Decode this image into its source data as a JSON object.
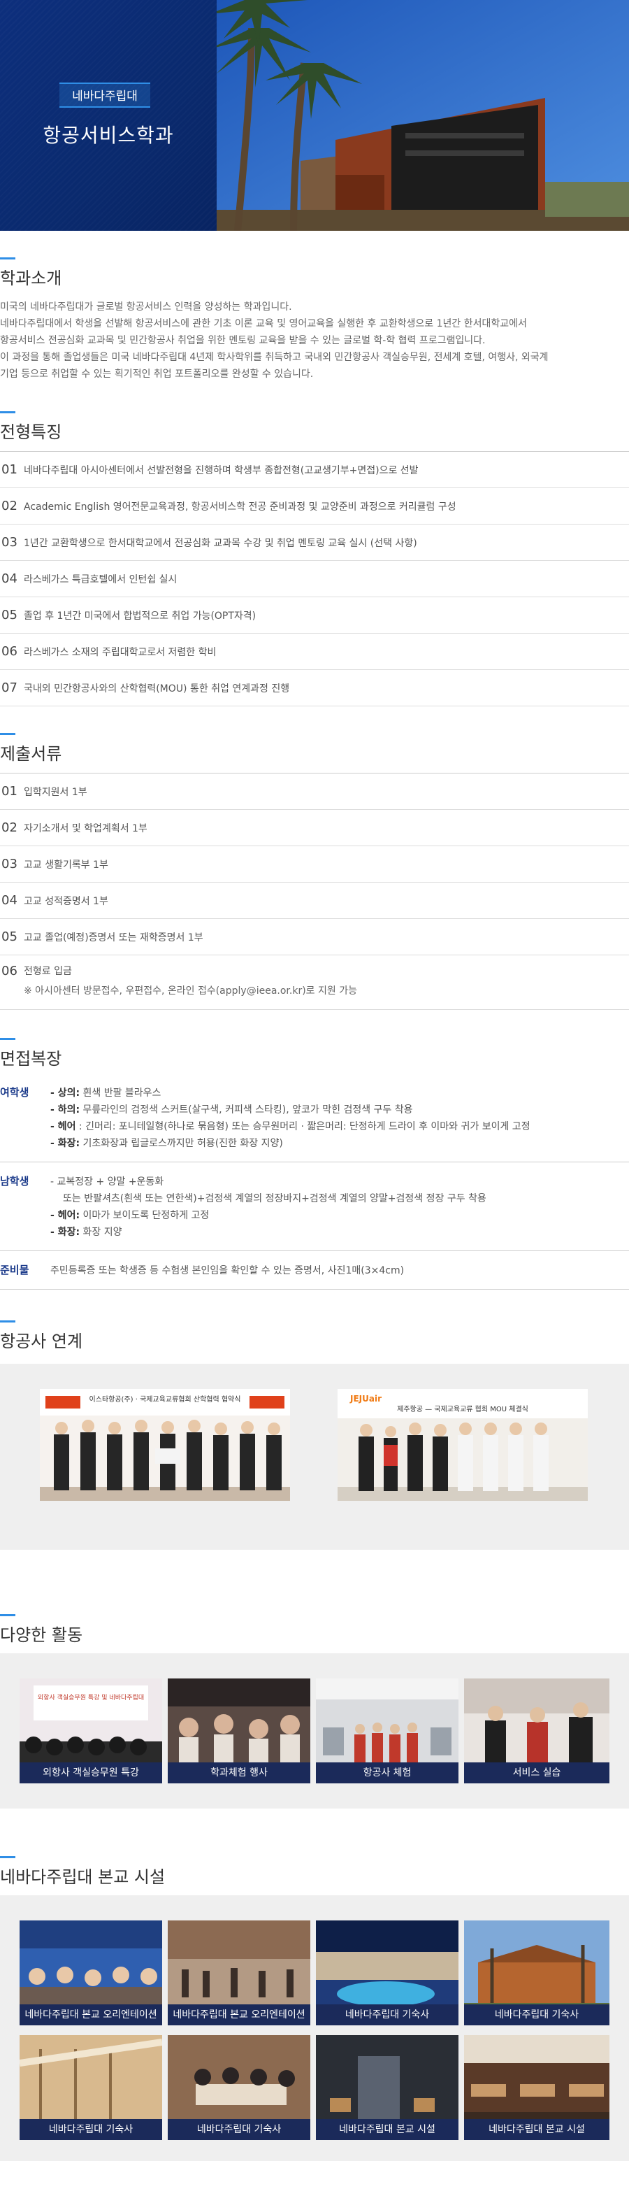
{
  "hero": {
    "badge": "네바다주립대",
    "title": "항공서비스학과",
    "photo_colors": {
      "sky": "#2a67c7",
      "building": "#8a3a1e"
    }
  },
  "intro": {
    "title": "학과소개",
    "lines": [
      "미국의 네바다주립대가 글로벌 항공서비스 인력을 양성하는 학과입니다.",
      "네바다주립대에서 학생을 선발해 항공서비스에 관한 기초 이론 교육 및 영어교육을 실행한 후 교환학생으로 1년간 한서대학교에서",
      "항공서비스 전공심화 교과목 및 민간항공사 취업을 위한 멘토링 교육을 받을 수 있는 글로벌 학-학 협력 프로그램입니다.",
      "이 과정을 통해 졸업생들은 미국 네바다주립대 4년제 학사학위를 취득하고 국내외 민간항공사 객실승무원, 전세계 호텔, 여행사, 외국계",
      "기업 등으로 취업할 수 있는 획기적인 취업 포트폴리오를 완성할 수 있습니다."
    ]
  },
  "features": {
    "title": "전형특징",
    "items": [
      {
        "num": "01",
        "text": "네바다주립대 아시아센터에서 선발전형을 진행하며 학생부 종합전형(고교생기부+면접)으로 선발"
      },
      {
        "num": "02",
        "text": "Academic English 영어전문교육과정, 항공서비스학 전공 준비과정 및 교양준비 과정으로 커리큘럼 구성"
      },
      {
        "num": "03",
        "text": "1년간 교환학생으로 한서대학교에서 전공심화 교과목 수강 및 취업 멘토링 교육 실시 (선택 사항)"
      },
      {
        "num": "04",
        "text": "라스베가스 특급호텔에서 인턴쉽 실시"
      },
      {
        "num": "05",
        "text": "졸업 후 1년간 미국에서 합법적으로 취업 가능(OPT자격)"
      },
      {
        "num": "06",
        "text": "라스베가스 소재의 주립대학교로서 저렴한 학비"
      },
      {
        "num": "07",
        "text": "국내외 민간항공사와의 산학협력(MOU) 통한 취업 연계과정 진행"
      }
    ]
  },
  "documents": {
    "title": "제출서류",
    "items": [
      {
        "num": "01",
        "text": "입학지원서 1부"
      },
      {
        "num": "02",
        "text": "자기소개서 및 학업계획서 1부"
      },
      {
        "num": "03",
        "text": "고교 생활기록부 1부"
      },
      {
        "num": "04",
        "text": "고교 성적증명서 1부"
      },
      {
        "num": "05",
        "text": "고교 졸업(예정)증명서 또는 재학증명서 1부"
      },
      {
        "num": "06",
        "text": "전형료 입금",
        "sub": "※ 아시아센터 방문접수, 우편접수, 온라인 접수(apply@ieea.or.kr)로 지원 가능"
      }
    ]
  },
  "dress": {
    "title": "면접복장",
    "female": {
      "label": "여학생",
      "lines": [
        {
          "k": "- 상의:",
          "v": " 흰색 반팔 블라우스"
        },
        {
          "k": "- 하의:",
          "v": " 무릎라인의 검정색 스커트(살구색, 커피색 스타킹), 앞코가 막힌 검정색 구두 착용"
        },
        {
          "k": "- 헤어",
          "v": " : 긴머리: 포니테일형(하나로 묶음형) 또는 승무원머리 · 짧은머리: 단정하게 드라이 후 이마와 귀가 보이게 고정"
        },
        {
          "k": "- 화장:",
          "v": " 기초화장과 립글로스까지만 허용(진한 화장 지양)"
        }
      ]
    },
    "male": {
      "label": "남학생",
      "lines": [
        {
          "k": "",
          "v": "- 교복정장 + 양말 +운동화"
        },
        {
          "k": "",
          "v": "  또는 반팔셔츠(흰색 또는 연한색)+검정색 계열의 정장바지+검정색 계열의 양말+검정색 정장 구두 착용"
        },
        {
          "k": "- 헤어:",
          "v": " 이마가 보이도록 단정하게 고정"
        },
        {
          "k": "- 화장:",
          "v": " 화장 지양"
        }
      ]
    },
    "prep": {
      "label": "준비물",
      "text": "주민등록증 또는 학생증 등 수험생 본인임을 확인할 수 있는 증명서, 사진1매(3×4cm)"
    }
  },
  "airline": {
    "title": "항공사 연계",
    "banners": [
      "이스타항공(주) · 국제교육교류협회 산학협력 협약식",
      "제주항공 — 국제교육교류 협회 MOU 체결식"
    ]
  },
  "activities": {
    "title": "다양한 활동",
    "items": [
      "외항사 객실승무원 특강",
      "학과체험 행사",
      "항공사 체험",
      "서비스 실습"
    ]
  },
  "facilities": {
    "title": "네바다주립대 본교 시설",
    "items": [
      "네바다주립대 본교 오리엔테이션",
      "네바다주립대 본교 오리엔테이션",
      "네바다주립대 기숙사",
      "네바다주립대 기숙사",
      "네바다주립대 기숙사",
      "네바다주립대 기숙사",
      "네바다주립대 본교 시설",
      "네바다주립대 본교 시설"
    ]
  }
}
